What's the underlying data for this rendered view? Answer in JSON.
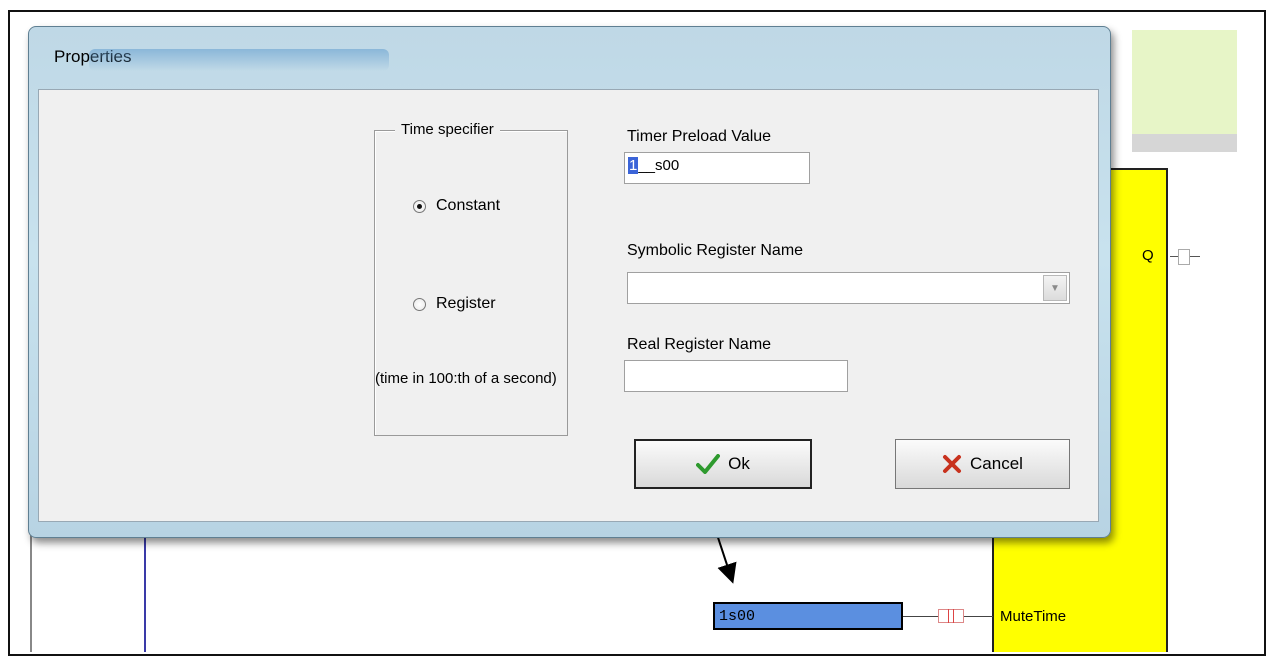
{
  "dialog": {
    "title": "Properties",
    "time_specifier": {
      "legend": "Time specifier",
      "options": [
        "Constant",
        "Register"
      ],
      "selected": "Constant",
      "note": "(time in 100:th of a second)"
    },
    "timer_preload": {
      "label": "Timer Preload Value",
      "value_selected": "1",
      "value_rest": "__s00"
    },
    "symbolic_register": {
      "label": "Symbolic Register Name",
      "value": ""
    },
    "real_register": {
      "label": "Real Register Name",
      "value": ""
    },
    "buttons": {
      "ok": "Ok",
      "cancel": "Cancel"
    }
  },
  "diagram": {
    "output_label": "Q",
    "value_box": "1s00",
    "input_label": "MuteTime"
  },
  "colors": {
    "block": "#ffff00",
    "value_box": "#5b8fe0",
    "ok_check": "#2e9a2e",
    "cancel_x": "#c8321e"
  }
}
